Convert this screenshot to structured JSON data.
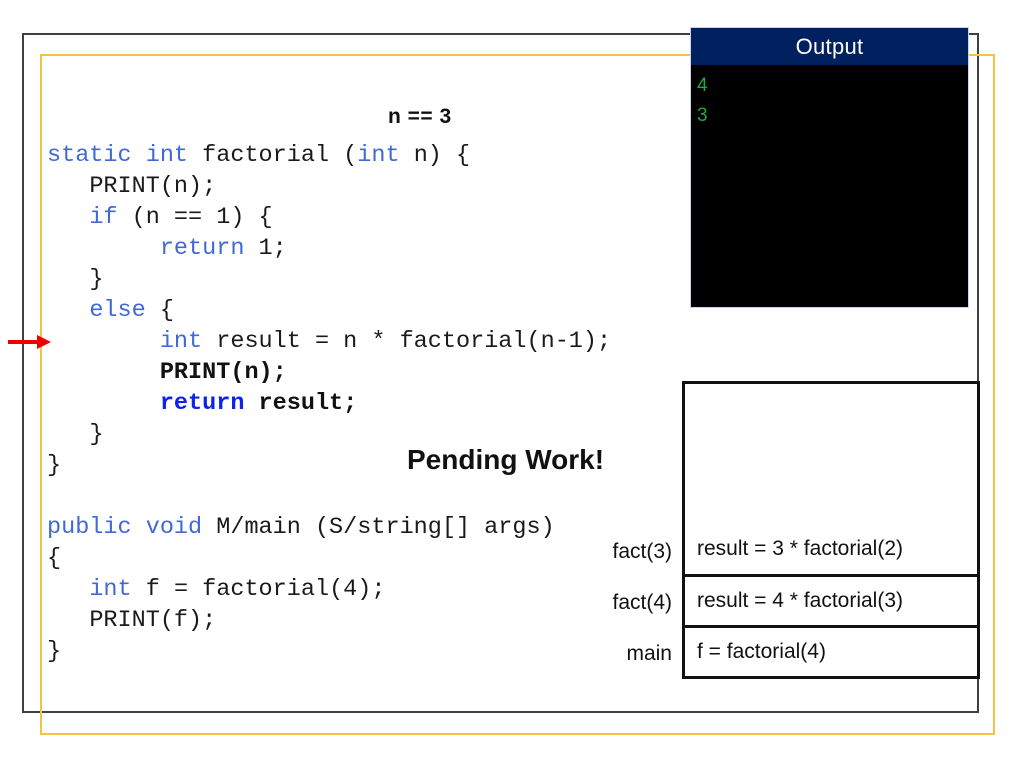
{
  "slide": {
    "annotation_n": "n == 3",
    "pending_work": "Pending Work!"
  },
  "output": {
    "title": "Output",
    "lines": [
      "4",
      "3"
    ],
    "title_bg": "#002060",
    "text_color": "#22B14C",
    "bg": "#000000"
  },
  "code": {
    "lines": [
      {
        "segments": [
          {
            "t": "static ",
            "s": "kw"
          },
          {
            "t": "int ",
            "s": "kw"
          },
          {
            "t": "factorial (",
            "s": "plain"
          },
          {
            "t": "int ",
            "s": "kw"
          },
          {
            "t": "n) {",
            "s": "plain"
          }
        ]
      },
      {
        "segments": [
          {
            "t": "   PRINT(n);",
            "s": "plain"
          }
        ]
      },
      {
        "segments": [
          {
            "t": "   ",
            "s": "plain"
          },
          {
            "t": "if ",
            "s": "kw"
          },
          {
            "t": "(n == 1) {",
            "s": "plain"
          }
        ]
      },
      {
        "segments": [
          {
            "t": "        ",
            "s": "plain"
          },
          {
            "t": "return ",
            "s": "kw"
          },
          {
            "t": "1;",
            "s": "plain"
          }
        ]
      },
      {
        "segments": [
          {
            "t": "   }",
            "s": "plain"
          }
        ]
      },
      {
        "segments": [
          {
            "t": "   ",
            "s": "plain"
          },
          {
            "t": "else ",
            "s": "kw"
          },
          {
            "t": "{",
            "s": "plain"
          }
        ]
      },
      {
        "segments": [
          {
            "t": "        ",
            "s": "plain"
          },
          {
            "t": "int ",
            "s": "kw"
          },
          {
            "t": "result = n * factorial(n-1);",
            "s": "plain"
          }
        ]
      },
      {
        "segments": [
          {
            "t": "        PRINT(n);",
            "s": "bold"
          }
        ]
      },
      {
        "segments": [
          {
            "t": "        ",
            "s": "bold"
          },
          {
            "t": "return ",
            "s": "kw-strong"
          },
          {
            "t": "result;",
            "s": "bold"
          }
        ]
      },
      {
        "segments": [
          {
            "t": "   }",
            "s": "plain"
          }
        ]
      },
      {
        "segments": [
          {
            "t": "}",
            "s": "plain"
          }
        ]
      },
      {
        "segments": [
          {
            "t": "",
            "s": "plain"
          }
        ]
      },
      {
        "segments": [
          {
            "t": "public ",
            "s": "kw"
          },
          {
            "t": "void ",
            "s": "kw"
          },
          {
            "t": "M/main (S/string[] args)",
            "s": "plain"
          }
        ]
      },
      {
        "segments": [
          {
            "t": "{",
            "s": "plain"
          }
        ]
      },
      {
        "segments": [
          {
            "t": "   ",
            "s": "plain"
          },
          {
            "t": "int ",
            "s": "kw"
          },
          {
            "t": "f = factorial(4);",
            "s": "plain"
          }
        ]
      },
      {
        "segments": [
          {
            "t": "   PRINT(f);",
            "s": "plain"
          }
        ]
      },
      {
        "segments": [
          {
            "t": "}",
            "s": "plain"
          }
        ]
      }
    ],
    "colors": {
      "keyword": "#4169d6",
      "keyword_bold": "#0b24e8",
      "plain": "#1a1a1a"
    }
  },
  "call_stack": {
    "frames": [
      {
        "label": "fact(3)",
        "body": "result = 3 * factorial(2)"
      },
      {
        "label": "fact(4)",
        "body": "result = 4 * factorial(3)"
      },
      {
        "label": "main",
        "body": "f = factorial(4)"
      }
    ]
  },
  "arrow": {
    "color": "#EE0000",
    "name": "current-execution-pointer"
  },
  "frames_decor": {
    "outer_color": "#404040",
    "inner_color": "#F5C243"
  }
}
